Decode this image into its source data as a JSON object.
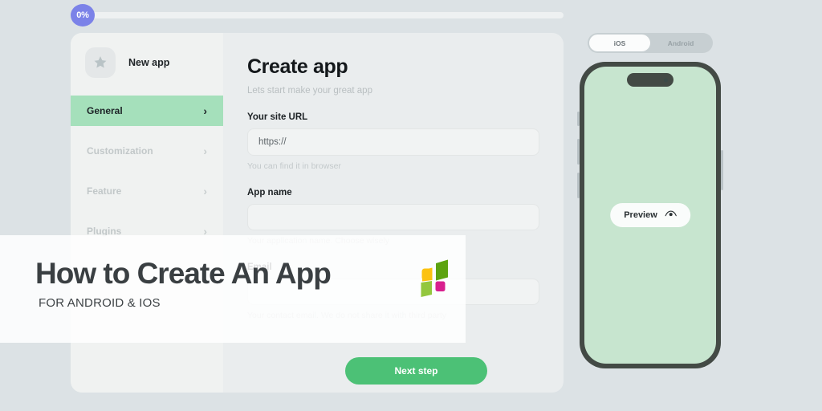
{
  "progress": {
    "badge_label": "0%",
    "percent": 0
  },
  "sidebar": {
    "app_name": "New app",
    "avatar_icon": "star-icon",
    "items": [
      {
        "label": "General",
        "active": true,
        "chevron": "›"
      },
      {
        "label": "Customization",
        "active": false,
        "chevron": "›"
      },
      {
        "label": "Feature",
        "active": false,
        "chevron": "›"
      },
      {
        "label": "Plugins",
        "active": false,
        "chevron": "›"
      }
    ]
  },
  "form": {
    "title": "Create app",
    "subtitle": "Lets start make your great app",
    "fields": [
      {
        "label": "Your site URL",
        "value": "https://",
        "hint": "You can find it in browser"
      },
      {
        "label": "App name",
        "value": "",
        "hint": "Your application name. Choose wisely"
      },
      {
        "label": "Email",
        "value": "",
        "hint": "Your contact email. We do not share it with third party"
      }
    ],
    "submit_label": "Next step"
  },
  "preview": {
    "platforms": [
      {
        "label": "iOS",
        "selected": true
      },
      {
        "label": "Android",
        "selected": false
      }
    ],
    "preview_label": "Preview",
    "preview_icon": "eye-icon"
  },
  "overlay": {
    "title": "How to Create An App",
    "subtitle": "FOR ANDROID & IOS",
    "logo_name": "four-square-logo"
  },
  "colors": {
    "background": "#dce2e5",
    "card": "#eaedee",
    "sidebar": "#f0f2f1",
    "accent_green": "#4cc176",
    "active_nav": "#a5e0bb",
    "progress_purple": "#7b82e8",
    "phone_frame": "#434a45",
    "phone_screen": "#c7e5cf",
    "logo_yellow": "#fcc210",
    "logo_dark_green": "#5da310",
    "logo_light_green": "#93c73e",
    "logo_magenta": "#d81f8e"
  }
}
